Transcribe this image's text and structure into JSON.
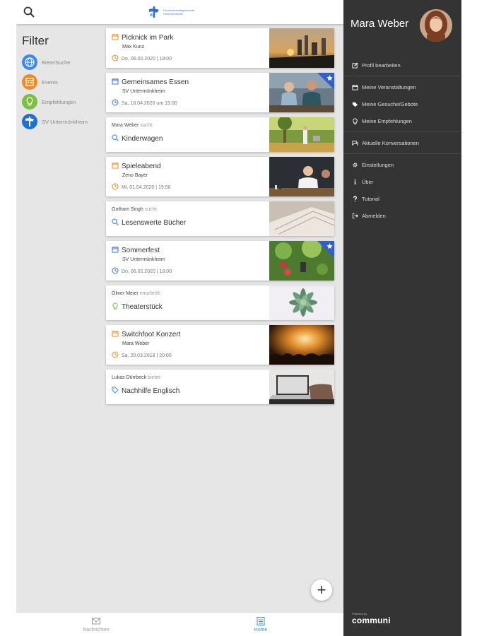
{
  "logo": {
    "text": "Gemeinschaftsgemeinde Untermünkheim"
  },
  "filter": {
    "title": "Filter",
    "items": [
      {
        "label": "Biete/Suche",
        "color": "#3d8be8",
        "icon": "globe-icon"
      },
      {
        "label": "Events",
        "color": "#f08a24",
        "icon": "calendar-icon"
      },
      {
        "label": "Empfehlungen",
        "color": "#7bc043",
        "icon": "bulb-icon"
      },
      {
        "label": "SV Untermünkheim",
        "color": "#1e6fd9",
        "icon": "club-icon"
      }
    ]
  },
  "feed": [
    {
      "type": "event",
      "title": "Picknick im Park",
      "author": "Max Kunz",
      "date": "Do, 06.02.2020 | 18:00",
      "accent": "#f08a24",
      "featured": false,
      "image": "city-sunset"
    },
    {
      "type": "event",
      "title": "Gemeinsames Essen",
      "author": "SV Untermünkheim",
      "date": "Sa, 18.04.2020 um 19:00",
      "accent": "#3d6fd6",
      "featured": true,
      "image": "friends"
    },
    {
      "type": "post",
      "author": "Mara Weber",
      "verb": "sucht:",
      "title": "Kinderwagen",
      "icon": "search-icon",
      "accent": "#3d8be8",
      "image": "park"
    },
    {
      "type": "event",
      "title": "Spieleabend",
      "author": "Zeno Bayer",
      "date": "Mi, 01.04.2020 | 19:00",
      "accent": "#f08a24",
      "featured": false,
      "image": "games"
    },
    {
      "type": "post",
      "author": "Gotham Singh",
      "verb": "sucht:",
      "title": "Lesenswerte Bücher",
      "icon": "search-icon",
      "accent": "#3d8be8",
      "image": "book"
    },
    {
      "type": "event",
      "title": "Sommerfest",
      "author": "SV Untermünkheim",
      "date": "Do, 06.02.2020 | 18:00",
      "accent": "#3d6fd6",
      "featured": true,
      "image": "garden"
    },
    {
      "type": "post",
      "author": "Oliver Meier",
      "verb": "empfiehlt:",
      "title": "Theaterstück",
      "icon": "bulb-icon",
      "accent": "#7bc043",
      "image": "succulent"
    },
    {
      "type": "event",
      "title": "Switchfoot Konzert",
      "author": "Mara Weber",
      "date": "Sa, 20.03.2018 | 20:00",
      "accent": "#f08a24",
      "featured": false,
      "image": "concert"
    },
    {
      "type": "post",
      "author": "Lukas Dürrbeck",
      "verb": "bietet:",
      "title": "Nachhilfe Englisch",
      "icon": "tag-icon",
      "accent": "#3d8be8",
      "image": "laptop"
    }
  ],
  "sidebar": {
    "user_name": "Mara Weber",
    "menu": [
      {
        "label": "Profil bearbeiten",
        "icon": "edit-icon",
        "divider_after": true
      },
      {
        "label": "Meine Veranstaltungen",
        "icon": "calendar-icon",
        "divider_after": false
      },
      {
        "label": "Meine Gesuche/Gebote",
        "icon": "tags-icon",
        "divider_after": false
      },
      {
        "label": "Meine Empfehlungen",
        "icon": "bulb-icon",
        "divider_after": true
      },
      {
        "label": "Aktuelle Konversationen",
        "icon": "chat-icon",
        "divider_after": true
      },
      {
        "label": "Einstellungen",
        "icon": "gear-icon",
        "divider_after": false
      },
      {
        "label": "Über",
        "icon": "info-icon",
        "divider_after": false
      },
      {
        "label": "Tutorial",
        "icon": "question-icon",
        "divider_after": false
      },
      {
        "label": "Abmelden",
        "icon": "logout-icon",
        "divider_after": false
      }
    ],
    "brand_powered": "Powered by",
    "brand_name": "communi"
  },
  "fab": {
    "label": "+"
  },
  "bottom_nav": [
    {
      "label": "Nachrichten",
      "icon": "mail-icon",
      "active": false,
      "color": "#999999"
    },
    {
      "label": "Home",
      "icon": "home-icon",
      "active": true,
      "color": "#3d8be8"
    }
  ]
}
